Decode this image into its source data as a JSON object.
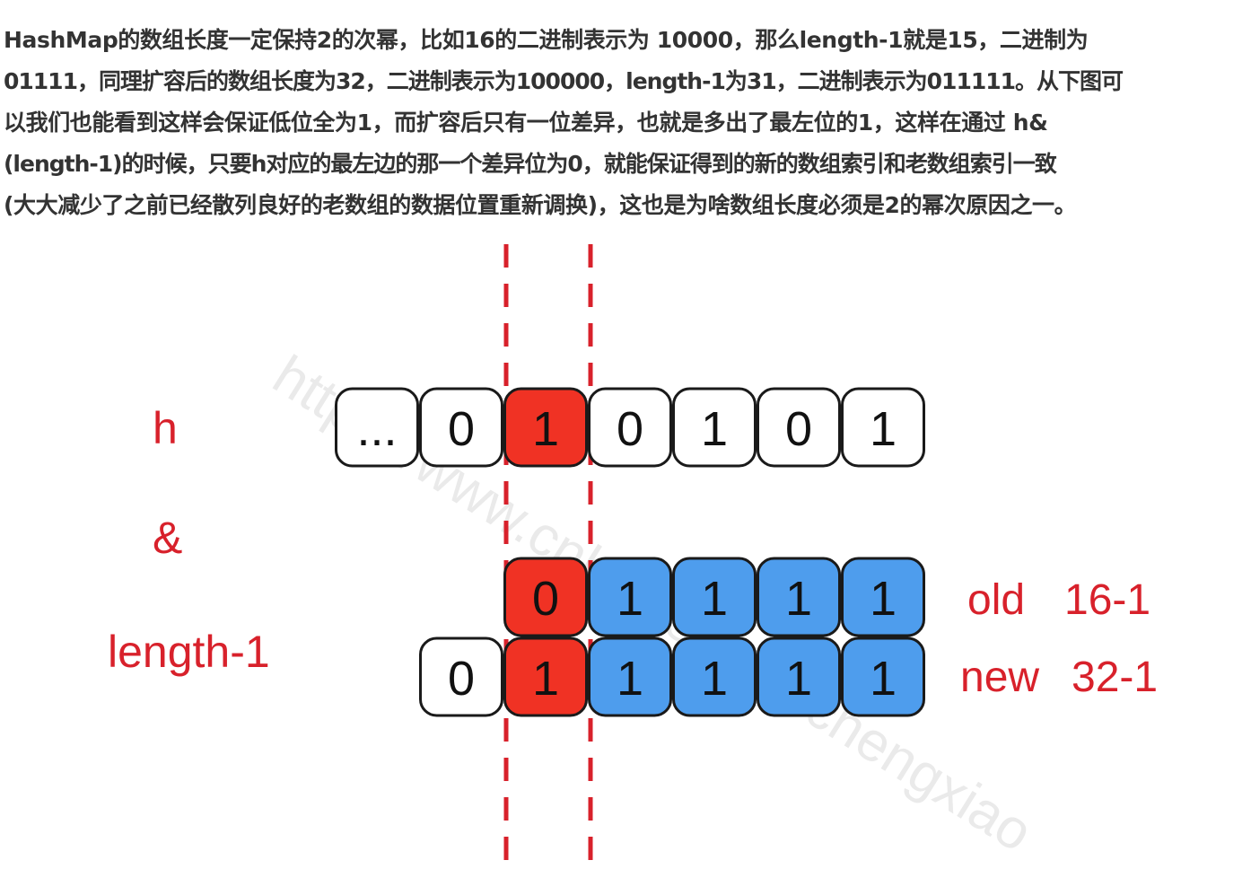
{
  "paragraph": {
    "lines": [
      "HashMap的数组长度一定保持2的次幂，比如16的二进制表示为 10000，那么length-1就是15，二进制为",
      "01111，同理扩容后的数组长度为32，二进制表示为100000，length-1为31，二进制表示为011111。从下图可",
      "以我们也能看到这样会保证低位全为1，而扩容后只有一位差异，也就是多出了最左位的1，这样在通过 h&",
      "(length-1)的时候，只要h对应的最左边的那一个差异位为0，就能保证得到的新的数组索引和老数组索引一致",
      "(大大减少了之前已经散列良好的老数组的数据位置重新调换)，这也是为啥数组长度必须是2的幂次原因之一。"
    ]
  },
  "labels": {
    "h": "h",
    "and": "&",
    "length_minus_1": "length-1",
    "old_word": "old",
    "old_value": "16-1",
    "new_word": "new",
    "new_value": "32-1"
  },
  "rows": {
    "h": [
      "...",
      "0",
      "1",
      "0",
      "1",
      "0",
      "1"
    ],
    "old": [
      "0",
      "1",
      "1",
      "1",
      "1"
    ],
    "new": [
      "0",
      "1",
      "1",
      "1",
      "1",
      "1"
    ]
  },
  "watermark": "https://www.cnblogs.com/chengxiao",
  "colors": {
    "red_fill": "#f03224",
    "blue_fill": "#4e9ded",
    "white_fill": "#ffffff",
    "stroke": "#1a1a1a",
    "label_red": "#d8212b",
    "dash_red": "#d8212b"
  }
}
